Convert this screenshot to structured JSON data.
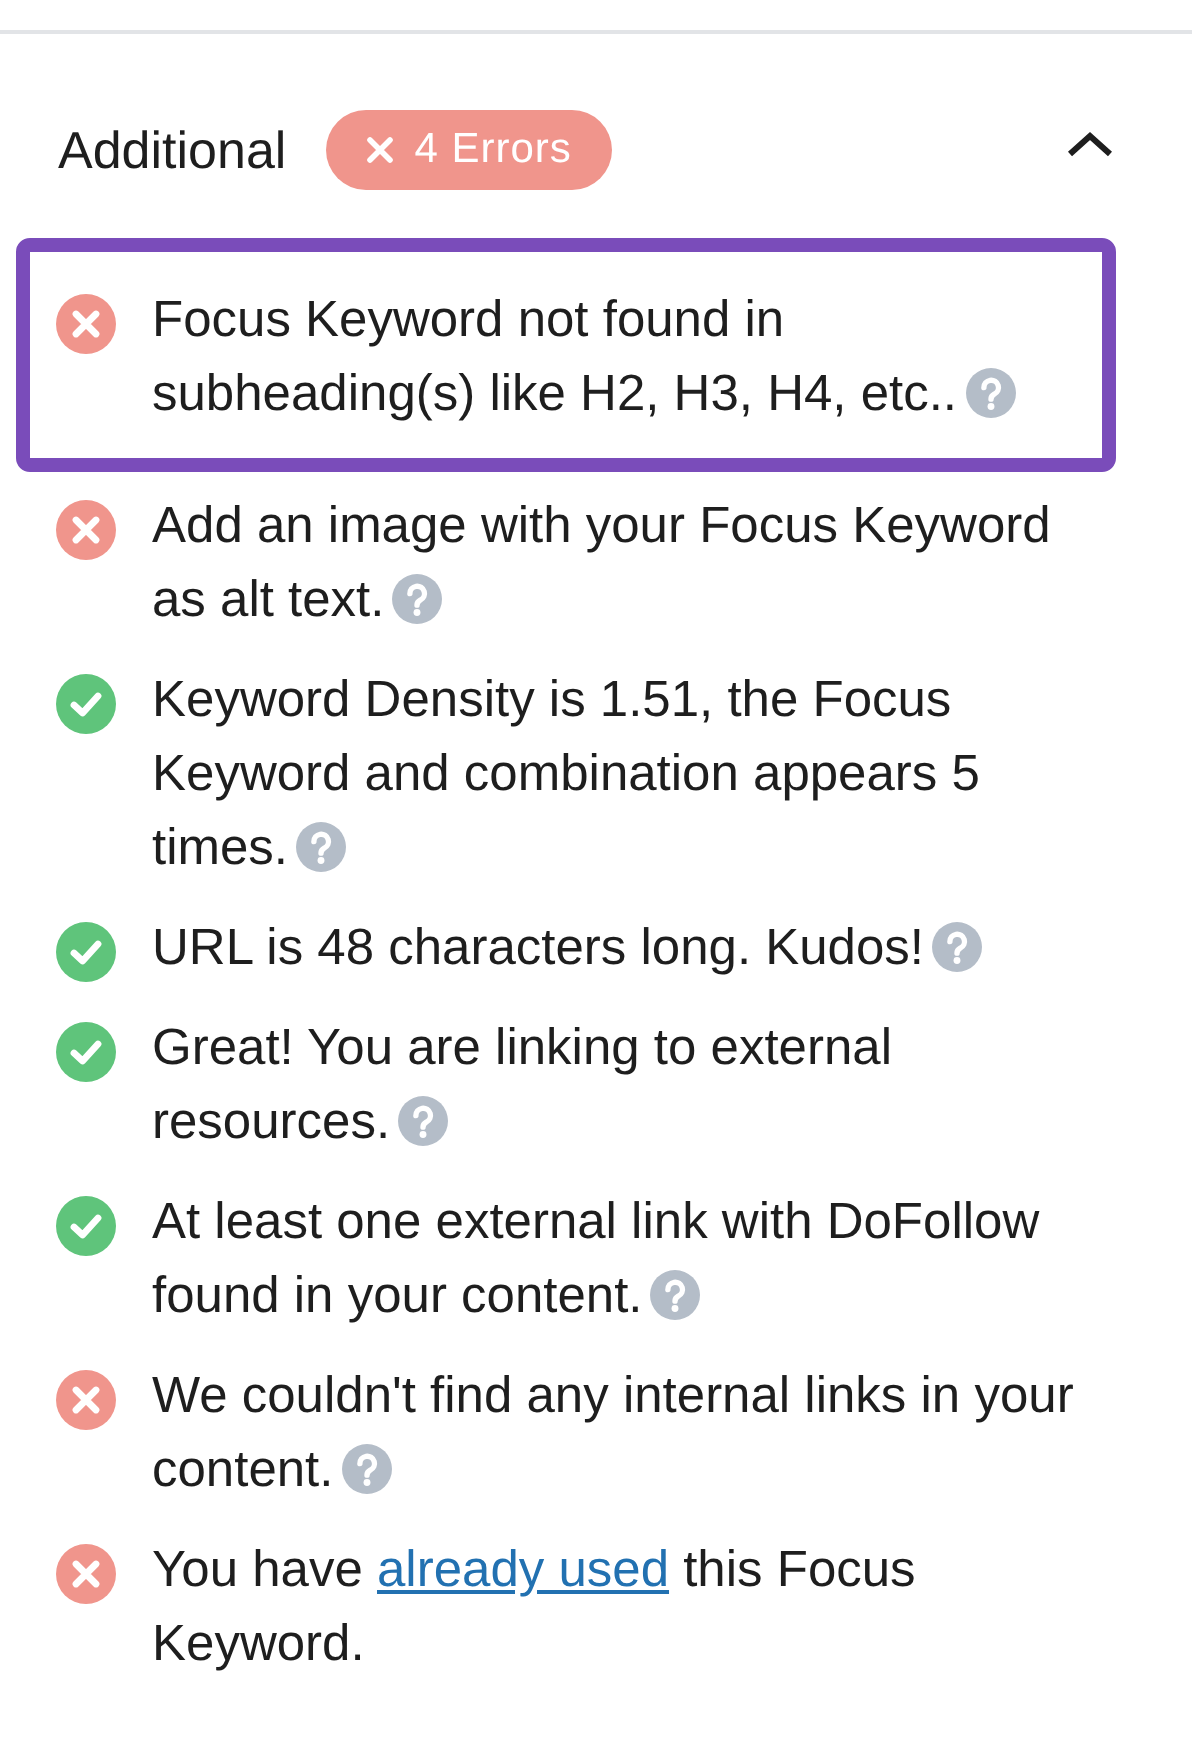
{
  "panel": {
    "title": "Additional",
    "badge": "4 Errors",
    "expanded": true
  },
  "checks": [
    {
      "passed": false,
      "highlighted": true,
      "help": true,
      "text": "Focus Keyword not found in subheading(s) like H2, H3, H4, etc.."
    },
    {
      "passed": false,
      "highlighted": false,
      "help": true,
      "text": "Add an image with your Focus Keyword as alt text."
    },
    {
      "passed": true,
      "highlighted": false,
      "help": true,
      "text": "Keyword Density is 1.51, the Focus Keyword and combination appears 5 times."
    },
    {
      "passed": true,
      "highlighted": false,
      "help": true,
      "text": "URL is 48 characters long. Kudos!"
    },
    {
      "passed": true,
      "highlighted": false,
      "help": true,
      "text": "Great! You are linking to external resources."
    },
    {
      "passed": true,
      "highlighted": false,
      "help": true,
      "text": "At least one external link with DoFollow found in your content."
    },
    {
      "passed": false,
      "highlighted": false,
      "help": true,
      "text": "We couldn't find any internal links in your content."
    },
    {
      "passed": false,
      "highlighted": false,
      "help": false,
      "text": "You have ",
      "link": "already used",
      "after": " this Focus Keyword."
    }
  ]
}
